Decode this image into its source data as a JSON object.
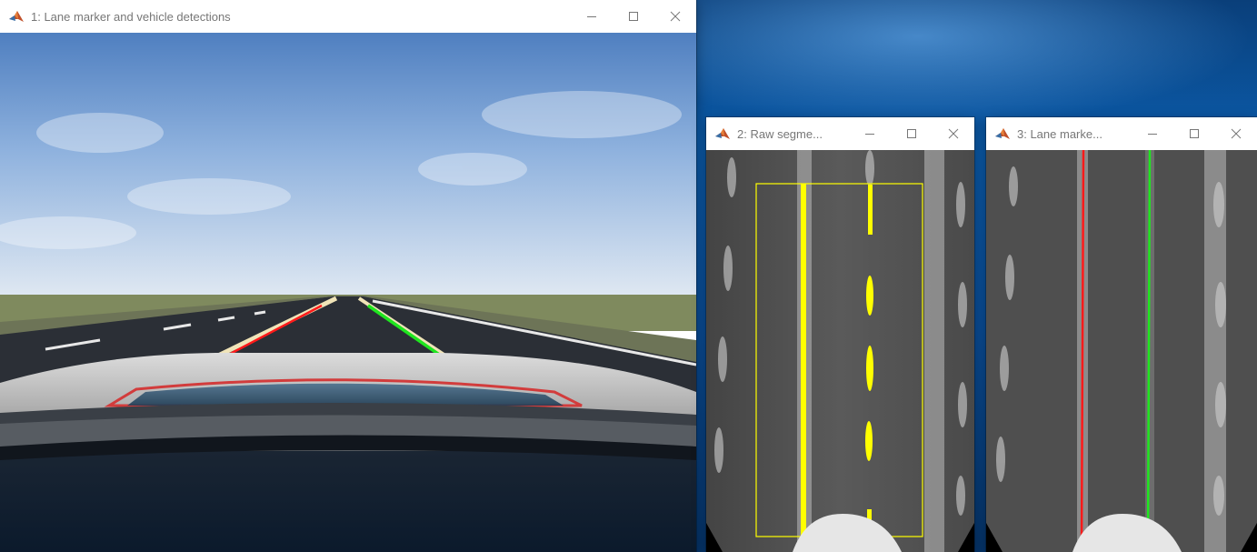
{
  "windows": {
    "w1": {
      "title": "1: Lane marker and vehicle detections"
    },
    "w2": {
      "title": "2: Raw segme..."
    },
    "w3": {
      "title": "3: Lane marke..."
    }
  },
  "colors": {
    "left_lane": "#ff1a1a",
    "right_lane": "#1fe61f",
    "segments": "#ffff00",
    "desktop_blue": "#0a4d97"
  },
  "icons": {
    "app": "matlab-icon",
    "minimize": "minimize-icon",
    "maximize": "maximize-icon",
    "close": "close-icon"
  }
}
